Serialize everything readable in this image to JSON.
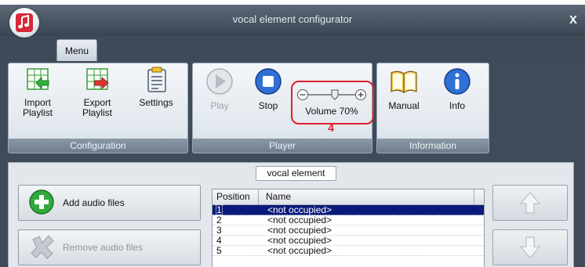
{
  "window": {
    "title": "vocal element configurator",
    "close_glyph": "x"
  },
  "menu": {
    "tab_label": "Menu"
  },
  "ribbon": {
    "groups": [
      {
        "label": "Configuration"
      },
      {
        "label": "Player"
      },
      {
        "label": "Information"
      }
    ],
    "import_playlist": {
      "label_line1": "Import",
      "label_line2": "Playlist",
      "icon": "import-playlist-icon"
    },
    "export_playlist": {
      "label_line1": "Export",
      "label_line2": "Playlist",
      "icon": "export-playlist-icon"
    },
    "settings": {
      "label": "Settings",
      "icon": "clipboard-icon"
    },
    "play": {
      "label": "Play",
      "icon": "play-icon",
      "enabled": false
    },
    "stop": {
      "label": "Stop",
      "icon": "stop-icon"
    },
    "volume": {
      "label": "Volume 70%",
      "level": 70,
      "annotation": "4"
    },
    "manual": {
      "label": "Manual",
      "icon": "book-icon"
    },
    "info": {
      "label": "Info",
      "icon": "info-icon"
    }
  },
  "vocal_element": {
    "section_label": "vocal element",
    "add_audio_label": "Add audio files",
    "remove_audio_label": "Remove audio files",
    "columns": [
      "Position",
      "Name"
    ],
    "rows": [
      {
        "position": "1",
        "name": "<not occupied>",
        "selected": true
      },
      {
        "position": "2",
        "name": "<not occupied>"
      },
      {
        "position": "3",
        "name": "<not occupied>"
      },
      {
        "position": "4",
        "name": "<not occupied>"
      },
      {
        "position": "5",
        "name": "<not occupied>"
      }
    ]
  },
  "colors": {
    "accent": "#e0202a",
    "selection": "#0a1a7a",
    "chrome": "#3f4b58"
  }
}
